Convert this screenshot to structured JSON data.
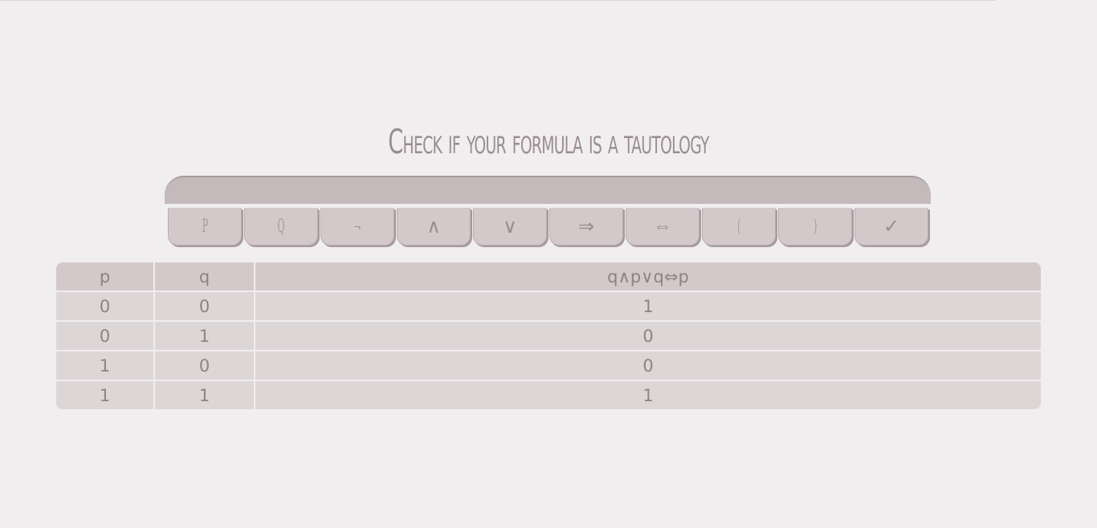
{
  "title": "Check if your formula is a tautology",
  "formula_input": {
    "value": "",
    "placeholder": ""
  },
  "keypad": [
    {
      "label": "P",
      "name": "key-p-button"
    },
    {
      "label": "Q",
      "name": "key-q-button"
    },
    {
      "label": "¬",
      "name": "key-not-button"
    },
    {
      "label": "∧",
      "name": "key-and-button"
    },
    {
      "label": "∨",
      "name": "key-or-button"
    },
    {
      "label": "⇒",
      "name": "key-implies-button"
    },
    {
      "label": "⇔",
      "name": "key-iff-button"
    },
    {
      "label": "(",
      "name": "key-open-paren-button"
    },
    {
      "label": ")",
      "name": "key-close-paren-button"
    },
    {
      "label": "✓",
      "name": "check-button"
    }
  ],
  "table": {
    "headers": [
      "p",
      "q",
      "q∧p∨q⇔p"
    ],
    "rows": [
      [
        "0",
        "0",
        "1"
      ],
      [
        "0",
        "1",
        "0"
      ],
      [
        "1",
        "0",
        "0"
      ],
      [
        "1",
        "1",
        "1"
      ]
    ]
  }
}
